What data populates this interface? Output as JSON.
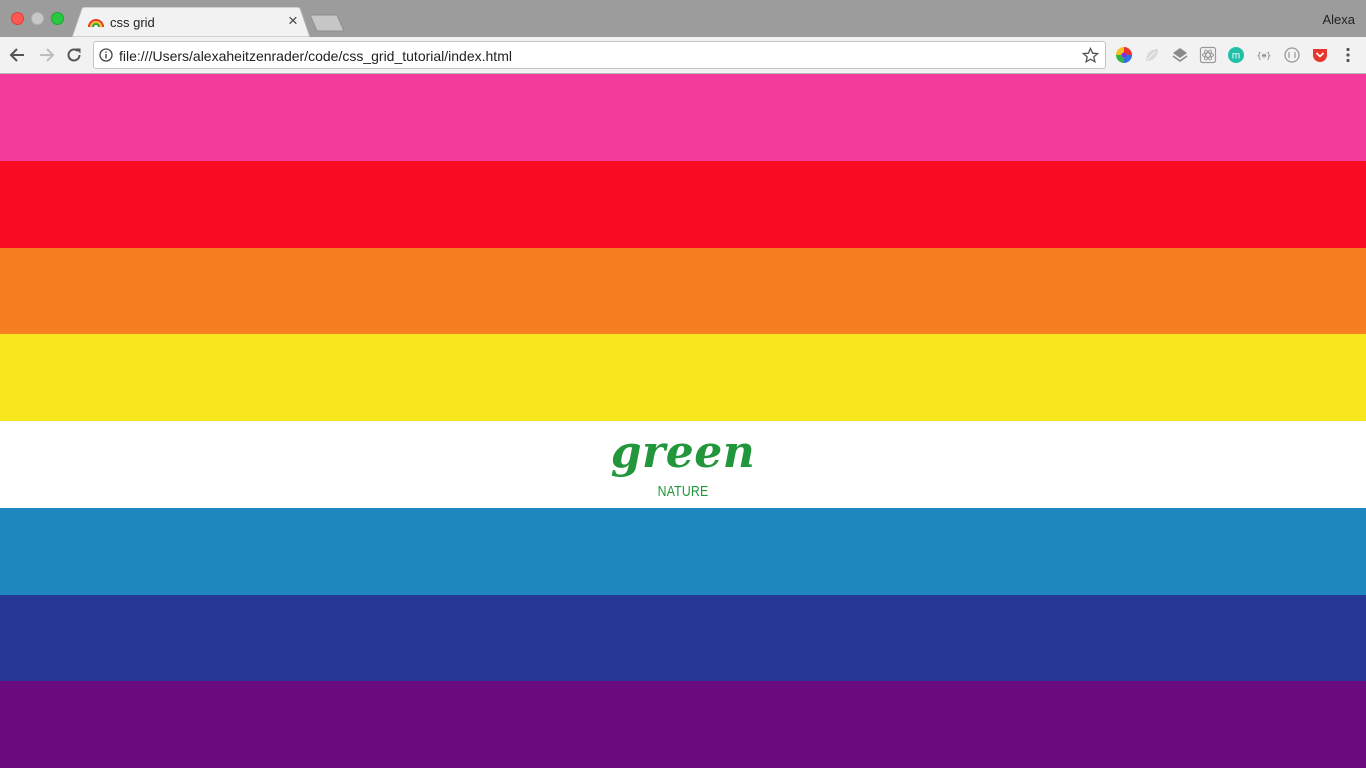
{
  "browser": {
    "tab_title": "css grid",
    "tab_close_glyph": "×",
    "profile_name": "Alexa",
    "url": "file:///Users/alexaheitzenrader/code/css_grid_tutorial/index.html",
    "icons": [
      "back-icon",
      "forward-icon",
      "reload-icon",
      "info-icon",
      "star-icon",
      "more-icon"
    ],
    "extensions": [
      "color-wheel-extension",
      "leaf-extension",
      "layers-extension",
      "react-devtools-extension",
      "m-extension",
      "json-extension",
      "circle-extension",
      "pocket-extension"
    ]
  },
  "page": {
    "stripes": [
      {
        "color": "#f23b9a",
        "title": "",
        "subtitle": ""
      },
      {
        "color": "#fa0c25",
        "title": "",
        "subtitle": ""
      },
      {
        "color": "#f77f22",
        "title": "",
        "subtitle": ""
      },
      {
        "color": "#f8e71e",
        "title": "",
        "subtitle": ""
      },
      {
        "color": "#ffffff",
        "title": "green",
        "subtitle": "NATURE",
        "text_color": "#22963b"
      },
      {
        "color": "#1e87be",
        "title": "",
        "subtitle": ""
      },
      {
        "color": "#263794",
        "title": "",
        "subtitle": ""
      },
      {
        "color": "#6c0a80",
        "title": "",
        "subtitle": ""
      }
    ]
  }
}
